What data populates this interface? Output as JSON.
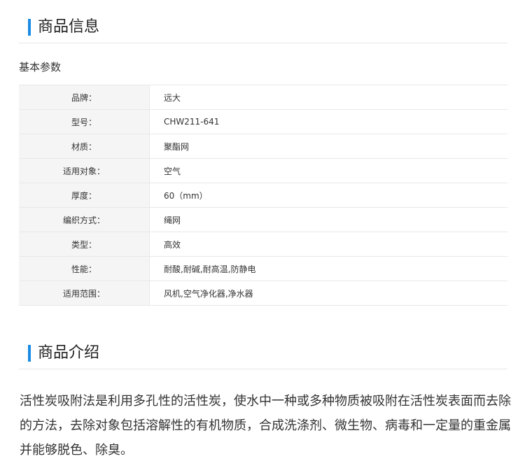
{
  "spec_section": {
    "title": "商品信息",
    "subheading": "基本参数",
    "rows": [
      {
        "label": "品牌：",
        "value": "远大"
      },
      {
        "label": "型号：",
        "value": "CHW211-641"
      },
      {
        "label": "材质：",
        "value": "聚酯网"
      },
      {
        "label": "适用对象：",
        "value": "空气"
      },
      {
        "label": "厚度：",
        "value": "60（mm）"
      },
      {
        "label": "编织方式：",
        "value": "绳网"
      },
      {
        "label": "类型：",
        "value": "高效"
      },
      {
        "label": "性能：",
        "value": "耐酸,耐碱,耐高温,防静电"
      },
      {
        "label": "适用范围：",
        "value": "风机,空气净化器,净水器"
      }
    ]
  },
  "intro_section": {
    "title": "商品介绍",
    "text": "活性炭吸附法是利用多孔性的活性炭，使水中一种或多种物质被吸附在活性炭表面而去除的方法，去除对象包括溶解性的有机物质，合成洗涤剂、微生物、病毒和一定量的重金属并能够脱色、除臭。"
  },
  "colors": {
    "accent": "#1a8be3",
    "label_bg": "#f5f5f5",
    "border": "#e8e8e8"
  }
}
